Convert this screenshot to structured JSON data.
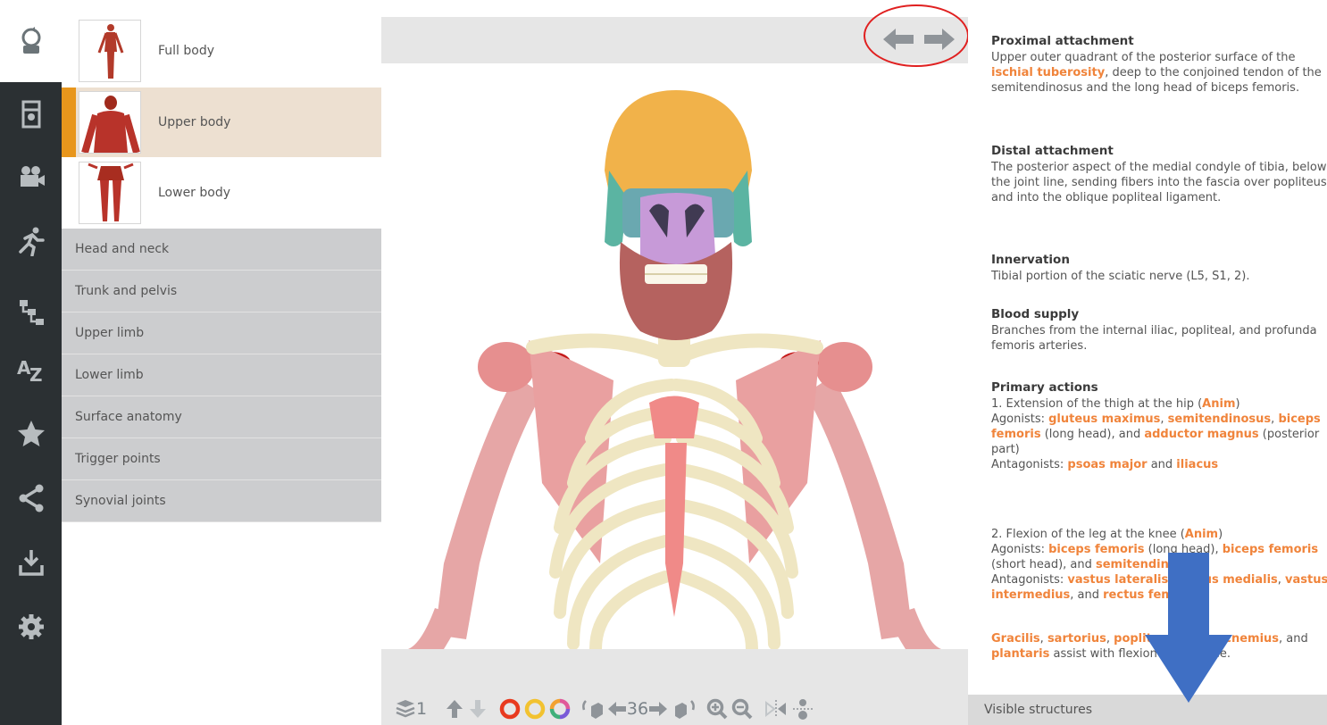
{
  "rail": {
    "items": [
      {
        "name": "reset-view-icon"
      },
      {
        "name": "atlas-icon"
      },
      {
        "name": "video-icon"
      },
      {
        "name": "running-figure-icon"
      },
      {
        "name": "hierarchy-icon"
      },
      {
        "name": "alphabetical-az-icon"
      },
      {
        "name": "star-icon"
      },
      {
        "name": "share-icon"
      },
      {
        "name": "download-icon"
      },
      {
        "name": "settings-gear-icon"
      }
    ]
  },
  "regions": [
    {
      "label": "Full body"
    },
    {
      "label": "Upper body"
    },
    {
      "label": "Lower body"
    }
  ],
  "categories": [
    "Head and neck",
    "Trunk and pelvis",
    "Upper limb",
    "Lower limb",
    "Surface anatomy",
    "Trigger points",
    "Synovial joints"
  ],
  "toolbar": {
    "layer_count": "1",
    "rotation_step": "36"
  },
  "info": {
    "proximal": {
      "heading": "Proximal attachment",
      "t1": "Upper outer quadrant of the posterior surface of the",
      "l1": "ischial tuberosity",
      "t2": ", deep to the conjoined tendon of the semitendinosus and the long head of biceps femoris."
    },
    "distal": {
      "heading": "Distal attachment",
      "text": "The posterior aspect of the medial condyle of tibia, below the joint line, sending fibers into the fascia over popliteus and into the oblique popliteal ligament."
    },
    "innervation": {
      "heading": "Innervation",
      "text": "Tibial portion of the sciatic nerve (L5, S1, 2)."
    },
    "blood": {
      "heading": "Blood supply",
      "text": "Branches from the internal iliac, popliteal, and profunda femoris arteries."
    },
    "actions": {
      "heading": "Primary actions",
      "a1_t": "1. Extension of the thigh at the hip (",
      "a1_link": "Anim",
      "a1_close": ")",
      "ag1_prefix": "Agonists: ",
      "ag1_l1": "gluteus maximus",
      "ag1_sep1": ", ",
      "ag1_l2": "semitendinosus",
      "ag1_sep2": ", ",
      "ag1_l3": "biceps femoris",
      "ag1_t": " (long head), and ",
      "ag1_l4": "adductor magnus",
      "ag1_end": " (posterior part)",
      "ant1_prefix": "Antagonists: ",
      "ant1_l1": "psoas major",
      "ant1_and": " and ",
      "ant1_l2": "iliacus",
      "a2_t": "2. Flexion of the leg at the knee (",
      "a2_link": "Anim",
      "a2_close": ")",
      "ag2_prefix": "Agonists: ",
      "ag2_l1": "biceps femoris",
      "ag2_t1": " (long head), ",
      "ag2_l2": "biceps femoris",
      "ag2_t2": " (short head), and ",
      "ag2_l3": "semitendinosus",
      "ant2_prefix": "Antagonists: ",
      "ant2_l1": "vastus lateralis",
      "ant2_sep1": ", ",
      "ant2_l2": "vastus medialis",
      "ant2_sep2": ", ",
      "ant2_l3": "vastus intermedius",
      "ant2_and": ", and ",
      "ant2_l4": "rectus femoris",
      "g_l1": "Gracilis",
      "g_s1": ", ",
      "g_l2": "sartorius",
      "g_s2": ", ",
      "g_l3": "popliteus",
      "g_s3": ", ",
      "g_l4": "gastrocnemius",
      "g_and": ", and ",
      "g_l5": "plantaris",
      "g_end": " assist with flexion of the knee."
    }
  },
  "visible_structures_label": "Visible structures",
  "colors": {
    "accent_orange": "#f0843b",
    "active_marker": "#e8961c",
    "annotation_red": "#e02020",
    "annotation_blue": "#3f6fc4"
  }
}
